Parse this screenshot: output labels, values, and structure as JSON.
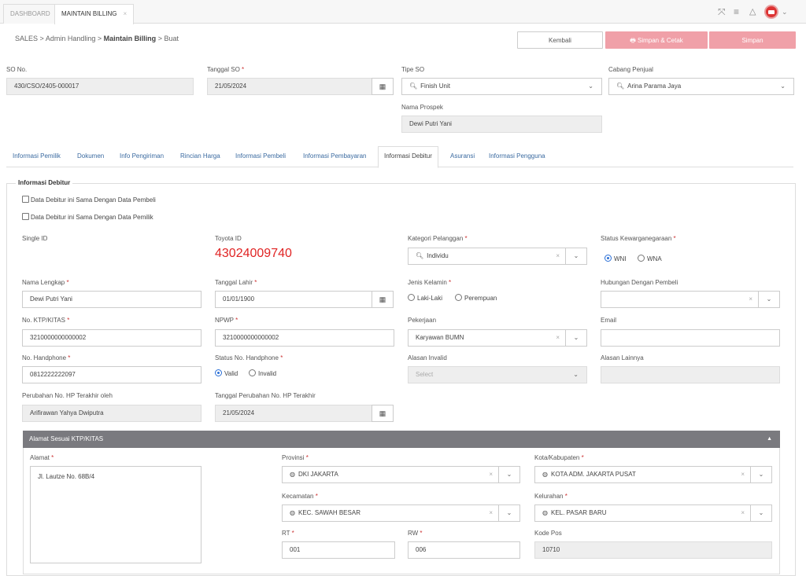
{
  "top_tabs": [
    {
      "label": "DASHBOARD"
    },
    {
      "label": "MAINTAIN BILLING",
      "close": "×"
    }
  ],
  "top_icons": {
    "expand": "⤧",
    "menu": "≡",
    "bell": "♫",
    "chevron": "⌄"
  },
  "breadcrumb": {
    "sales": "SALES",
    "sep": ">",
    "admin": "Admin Handling",
    "maintain": "Maintain Billing",
    "current": "Buat"
  },
  "buttons": {
    "kembali": "Kembali",
    "simpan_cetak": "Simpan & Cetak",
    "simpan": "Simpan"
  },
  "header_form": {
    "so_no": {
      "label": "SO No.",
      "value": "430/CSO/2405-000017"
    },
    "tanggal_so": {
      "label": "Tanggal SO",
      "value": "21/05/2024"
    },
    "tipe_so": {
      "label": "Tipe SO",
      "value": "Finish Unit"
    },
    "cabang": {
      "label": "Cabang Penjual",
      "value": "Arina Parama Jaya"
    },
    "nama_prospek": {
      "label": "Nama Prospek",
      "value": "Dewi Putri Yani"
    }
  },
  "tabs": [
    "Informasi Pemilik",
    "Dokumen",
    "Info Pengiriman",
    "Rincian Harga",
    "Informasi Pembeli",
    "Informasi Pembayaran",
    "Informasi Debitur",
    "Asuransi",
    "Informasi Pengguna"
  ],
  "debitur": {
    "legend": "Informasi Debitur",
    "chk_pembeli": "Data Debitur ini Sama Dengan Data Pembeli",
    "chk_pemilik": "Data Debitur ini Sama Dengan Data Pemilik",
    "single_id": {
      "label": "Single ID"
    },
    "toyota_id": {
      "label": "Toyota ID",
      "value": "43024009740"
    },
    "kategori": {
      "label": "Kategori Pelanggan",
      "value": "Individu"
    },
    "status_kw": {
      "label": "Status Kewarganegaraan",
      "opt1": "WNI",
      "opt2": "WNA"
    },
    "nama": {
      "label": "Nama Lengkap",
      "value": "Dewi Putri Yani"
    },
    "tgl_lahir": {
      "label": "Tanggal Lahir",
      "value": "01/01/1900"
    },
    "jenis_kelamin": {
      "label": "Jenis Kelamin",
      "opt1": "Laki-Laki",
      "opt2": "Perempuan"
    },
    "hubungan": {
      "label": "Hubungan Dengan Pembeli",
      "value": ""
    },
    "ktp": {
      "label": "No. KTP/KITAS",
      "value": "3210000000000002"
    },
    "npwp": {
      "label": "NPWP",
      "value": "3210000000000002"
    },
    "pekerjaan": {
      "label": "Pekerjaan",
      "value": "Karyawan BUMN"
    },
    "email": {
      "label": "Email",
      "value": ""
    },
    "hp": {
      "label": "No. Handphone",
      "value": "0812222222097"
    },
    "status_hp": {
      "label": "Status No. Handphone",
      "opt1": "Valid",
      "opt2": "Invalid"
    },
    "alasan_invalid": {
      "label": "Alasan Invalid",
      "placeholder": "Select"
    },
    "alasan_lain": {
      "label": "Alasan Lainnya",
      "value": ""
    },
    "perubahan_oleh": {
      "label": "Perubahan No. HP Terakhir oleh",
      "value": "Arifirawan Yahya Dwiputra"
    },
    "tgl_perubahan": {
      "label": "Tanggal Perubahan No. HP Terakhir",
      "value": "21/05/2024"
    }
  },
  "alamat_panel": {
    "title": "Alamat Sesuai KTP/KITAS",
    "alamat": {
      "label": "Alamat",
      "value": "Jl. Lautze No. 68B/4"
    },
    "provinsi": {
      "label": "Provinsi",
      "value": "DKI JAKARTA"
    },
    "kota": {
      "label": "Kota/Kabupaten",
      "value": "KOTA ADM. JAKARTA PUSAT"
    },
    "kecamatan": {
      "label": "Kecamatan",
      "value": "KEC. SAWAH BESAR"
    },
    "kelurahan": {
      "label": "Kelurahan",
      "value": "KEL. PASAR BARU"
    },
    "rt": {
      "label": "RT",
      "value": "001"
    },
    "rw": {
      "label": "RW",
      "value": "006"
    },
    "kode_pos": {
      "label": "Kode Pos",
      "value": "10710"
    }
  },
  "colors": {
    "accent": "#2a6fd6",
    "danger_btn": "#f0a0a8",
    "toyota_id": "#e02424",
    "panel_header": "#7a7a7f",
    "tab_link": "#3a6aa0"
  }
}
